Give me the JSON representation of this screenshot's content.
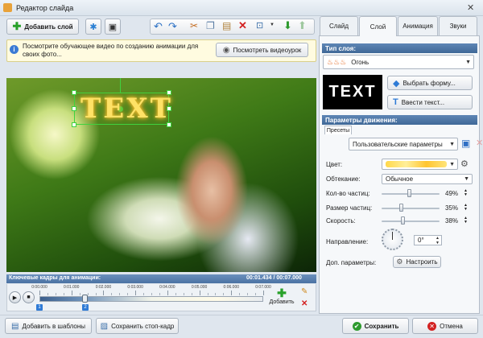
{
  "window": {
    "title": "Редактор слайда"
  },
  "toolbar": {
    "add_layer": "Добавить слой"
  },
  "info": {
    "text": "Посмотрите обучающее видео по созданию анимации для своих фото...",
    "video_button": "Посмотреть видеоурок"
  },
  "canvas": {
    "text_layer": "TEXT"
  },
  "timeline": {
    "header": "Ключевые кадры для анимации:",
    "time": "00:01.434 / 00:07.000",
    "ticks": [
      "0:00.000",
      "0:01.000",
      "0:02.000",
      "0:03.000",
      "0:04.000",
      "0:05.000",
      "0:06.000",
      "0:07.000"
    ],
    "keyframe1": "1",
    "keyframe2": "2",
    "add_label": "Добавить"
  },
  "tabs": [
    "Слайд",
    "Слой",
    "Анимация",
    "Звуки"
  ],
  "layer_type": {
    "header": "Тип слоя:",
    "value": "Огонь",
    "preview_text": "TEXT",
    "choose_shape": "Выбрать форму...",
    "enter_text": "Ввести текст..."
  },
  "motion": {
    "header": "Параметры движения:",
    "presets_tab": "Пресеты",
    "preset_value": "Пользовательские параметры",
    "color_label": "Цвет:",
    "wrap_label": "Обтекание:",
    "wrap_value": "Обычное",
    "particles_label": "Кол-во частиц:",
    "particles_value": "49%",
    "particles": 0.49,
    "size_label": "Размер частиц:",
    "size_value": "35%",
    "size": 0.35,
    "speed_label": "Скорость:",
    "speed_value": "38%",
    "speed": 0.38,
    "direction_label": "Направление:",
    "direction_value": "0°",
    "extra_label": "Доп. параметры:",
    "configure_button": "Настроить"
  },
  "bottom": {
    "add_templates": "Добавить в шаблоны",
    "save_frame": "Сохранить стоп-кадр",
    "save": "Сохранить",
    "cancel": "Отмена"
  }
}
